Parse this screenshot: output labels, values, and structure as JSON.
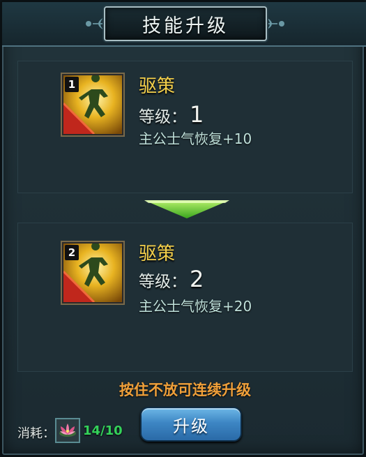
{
  "dialog": {
    "title": "技能升级"
  },
  "current_skill": {
    "badge": "1",
    "name": "驱策",
    "level_label": "等级：",
    "level_value": "1",
    "effect": "主公士气恢复+10",
    "icon": "running-figure-skill-icon"
  },
  "next_skill": {
    "badge": "2",
    "name": "驱策",
    "level_label": "等级：",
    "level_value": "2",
    "effect": "主公士气恢复+20",
    "icon": "running-figure-skill-icon"
  },
  "hint": "按住不放可连续升级",
  "cost": {
    "label": "消耗：",
    "item_icon": "lotus-flower-icon",
    "count": "14/10"
  },
  "upgrade_button": {
    "label": "升级"
  },
  "colors": {
    "skill_name": "#f5d04a",
    "hint": "#f0a03a",
    "cost_count": "#34d25a",
    "button": "#3d86c4",
    "arrow": "#6fd63a"
  }
}
